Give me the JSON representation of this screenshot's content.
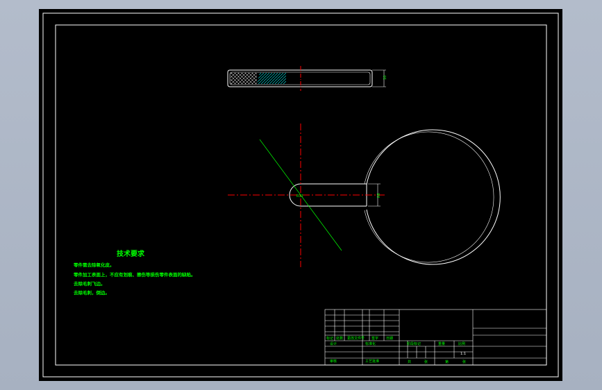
{
  "drawing": {
    "colors": {
      "background": "#000000",
      "outline": "#ffffff",
      "centerline": "#ff0000",
      "annotation": "#00ff00",
      "hatch": "#00ffff"
    },
    "dimensions": {
      "thickness": "10",
      "slot_width": "R8",
      "center_radius": "R12"
    },
    "technical_requirements": {
      "title": "技术要求",
      "items": [
        "零件需去除氧化皮。",
        "零件加工表面上，不应有划痕、擦伤等损伤零件表面的缺陷。",
        "去除毛刺飞边。",
        "去除毛刺，倒边。"
      ]
    },
    "title_block": {
      "labels": [
        "标记",
        "处数",
        "更改文件号",
        "签字",
        "日期",
        "设计",
        "标准化",
        "阶段标记",
        "重量",
        "比例",
        "审核",
        "工艺",
        "批准",
        "共",
        "张",
        "第",
        "张"
      ],
      "scale": "1:1"
    }
  }
}
